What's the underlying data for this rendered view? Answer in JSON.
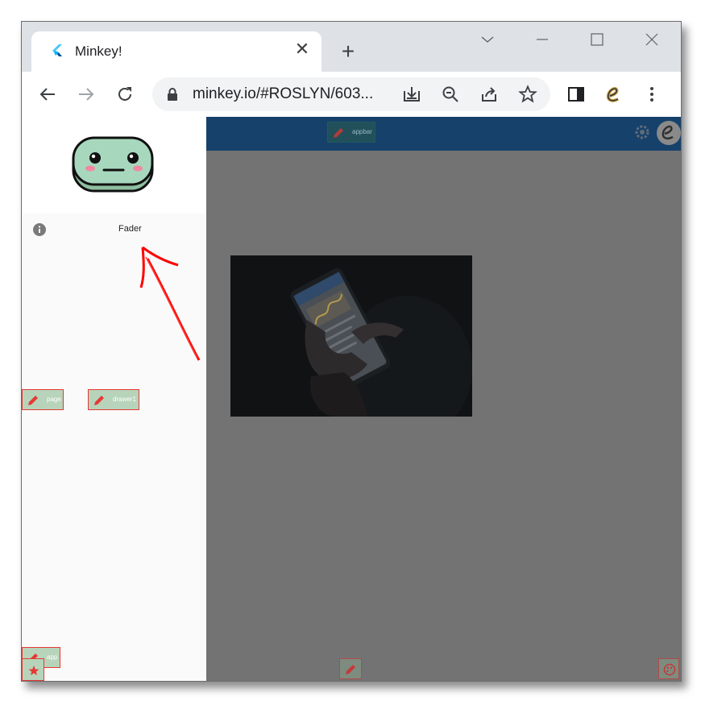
{
  "browser": {
    "tab_title": "Minkey!",
    "url": "minkey.io/#ROSLYN/603...",
    "new_tab_symbol": "+",
    "close_tab_symbol": "✕"
  },
  "drawer": {
    "item_label": "Fader"
  },
  "edit_badges": {
    "page": "page",
    "drawer": "drawer1",
    "appbar": "appbar",
    "app": "app"
  },
  "colors": {
    "appbar": "#16416b",
    "overlay": "#737373",
    "badge_fill": "#b7d4ba",
    "badge_border": "#e53935",
    "annotation_arrow": "#ff0000"
  }
}
